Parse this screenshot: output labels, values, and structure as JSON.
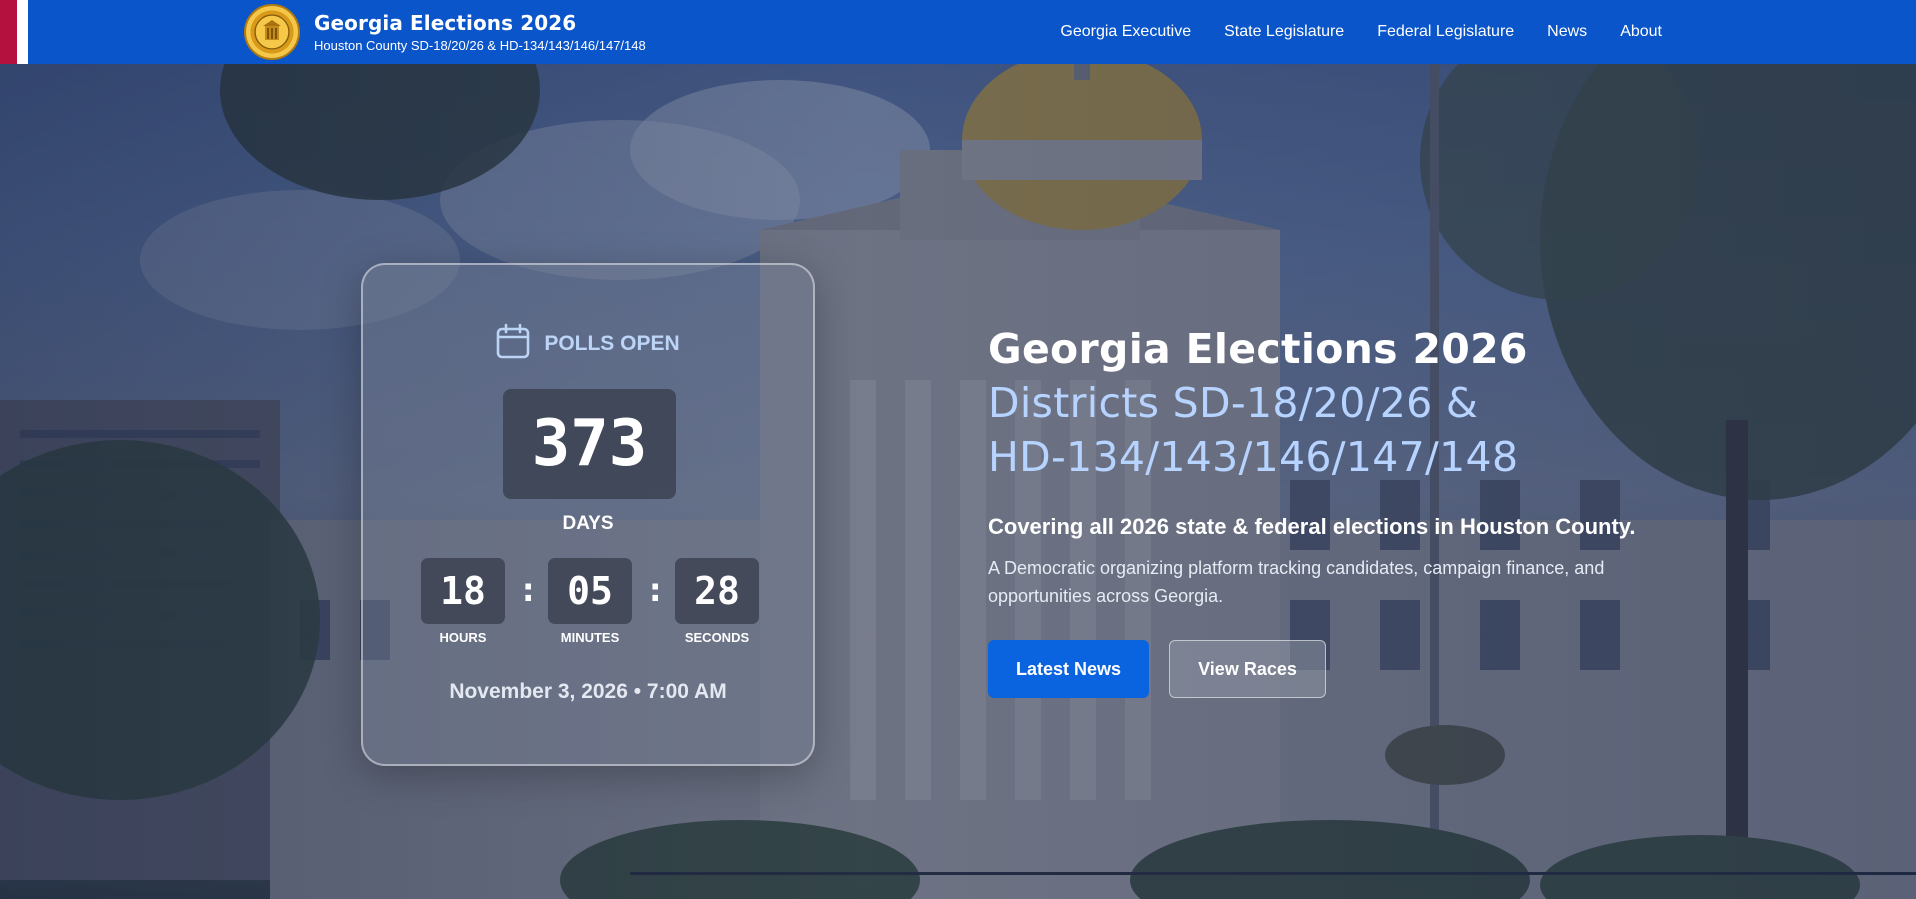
{
  "brand": {
    "title": "Georgia Elections 2026",
    "subtitle": "Houston County SD-18/20/26 & HD-134/143/146/147/148",
    "seal_icon": "state-seal-icon"
  },
  "nav": {
    "items": [
      {
        "label": "Georgia Executive"
      },
      {
        "label": "State Legislature"
      },
      {
        "label": "Federal Legislature"
      },
      {
        "label": "News"
      },
      {
        "label": "About"
      }
    ]
  },
  "countdown": {
    "icon": "calendar-icon",
    "heading": "POLLS OPEN",
    "days": "373",
    "days_label": "DAYS",
    "hours": "18",
    "hours_label": "HOURS",
    "minutes": "05",
    "minutes_label": "MINUTES",
    "seconds": "28",
    "seconds_label": "SECONDS",
    "separator": ":",
    "date": "November 3, 2026 • 7:00 AM"
  },
  "hero": {
    "title": "Georgia Elections 2026",
    "districts_line1": "Districts SD-18/20/26 &",
    "districts_line2": "HD-134/143/146/147/148",
    "coverage": "Covering all 2026 state & federal elections in Houston County.",
    "description": "A Democratic organizing platform tracking candidates, campaign finance, and opportunities across Georgia.",
    "primary_button": "Latest News",
    "secondary_button": "View Races"
  },
  "colors": {
    "nav_bg": "#0a55c9",
    "accent_light_blue": "#b7d3ff",
    "primary_button": "#0a63df",
    "flag_red": "#b5113f"
  }
}
